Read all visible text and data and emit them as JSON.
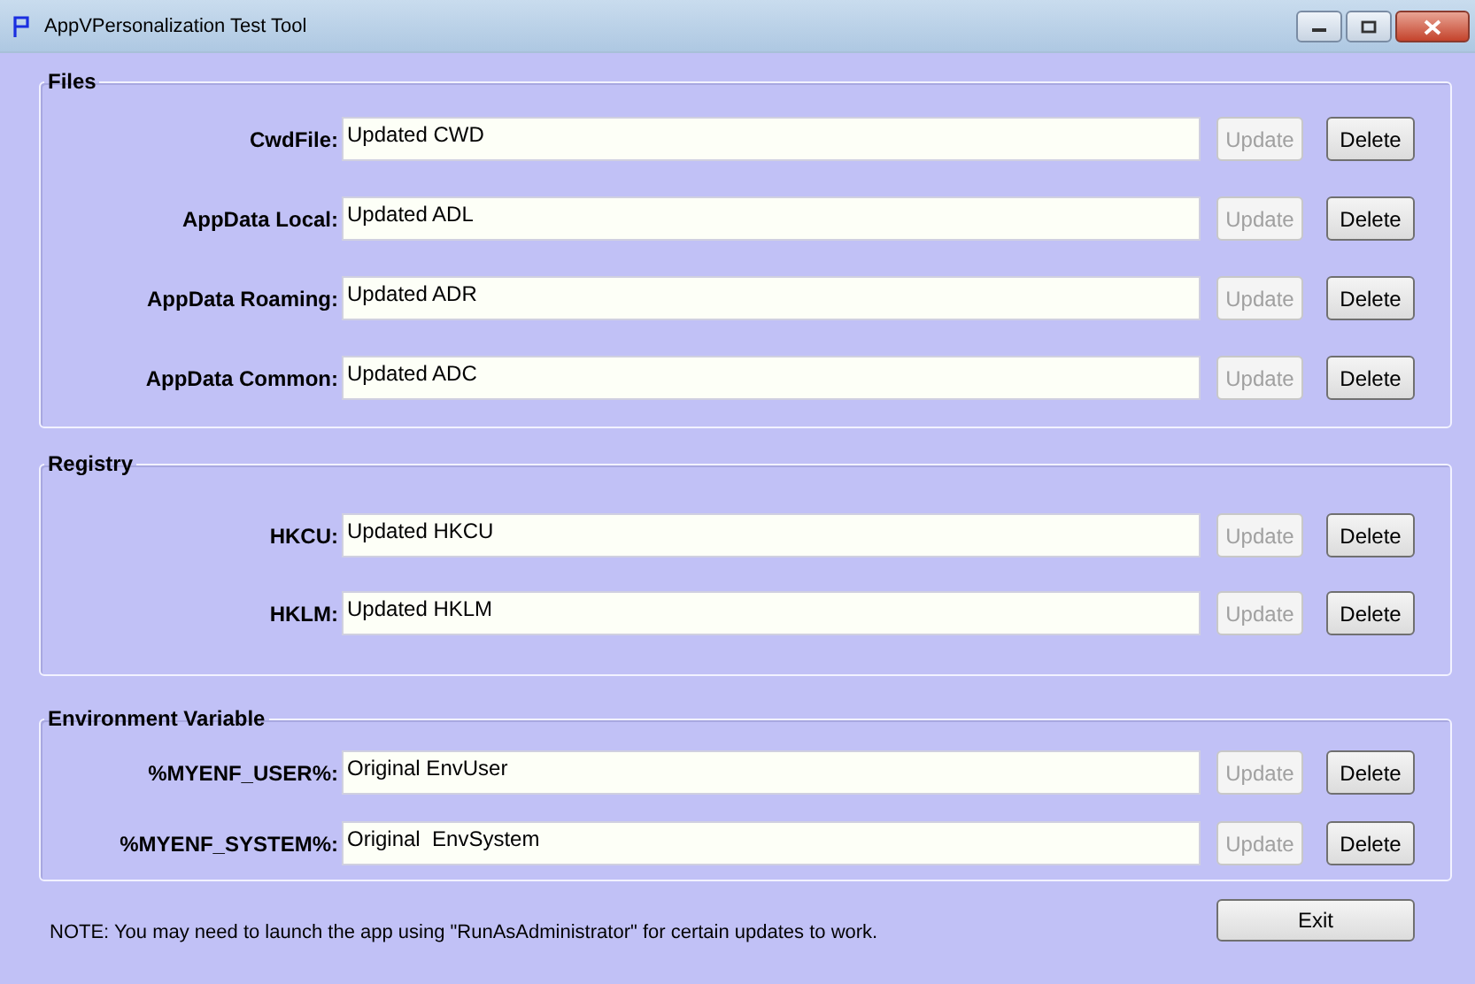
{
  "window": {
    "title": "AppVPersonalization Test Tool"
  },
  "groups": [
    {
      "title": "Files",
      "rows": [
        {
          "label": "CwdFile:",
          "value": "Updated CWD",
          "update": {
            "label": "Update",
            "disabled": true
          },
          "delete": {
            "label": "Delete",
            "disabled": false
          }
        },
        {
          "label": "AppData Local:",
          "value": "Updated ADL",
          "update": {
            "label": "Update",
            "disabled": true
          },
          "delete": {
            "label": "Delete",
            "disabled": false
          }
        },
        {
          "label": "AppData Roaming:",
          "value": "Updated ADR",
          "update": {
            "label": "Update",
            "disabled": true
          },
          "delete": {
            "label": "Delete",
            "disabled": false
          }
        },
        {
          "label": "AppData Common:",
          "value": "Updated ADC",
          "update": {
            "label": "Update",
            "disabled": true
          },
          "delete": {
            "label": "Delete",
            "disabled": false
          }
        }
      ]
    },
    {
      "title": "Registry",
      "rows": [
        {
          "label": "HKCU:",
          "value": "Updated HKCU",
          "update": {
            "label": "Update",
            "disabled": true
          },
          "delete": {
            "label": "Delete",
            "disabled": false
          }
        },
        {
          "label": "HKLM:",
          "value": "Updated HKLM",
          "update": {
            "label": "Update",
            "disabled": true
          },
          "delete": {
            "label": "Delete",
            "disabled": false
          }
        }
      ]
    },
    {
      "title": "Environment Variable",
      "rows": [
        {
          "label": "%MYENF_USER%:",
          "value": "Original EnvUser",
          "update": {
            "label": "Update",
            "disabled": true
          },
          "delete": {
            "label": "Delete",
            "disabled": false
          }
        },
        {
          "label": "%MYENF_SYSTEM%:",
          "value": "Original  EnvSystem",
          "update": {
            "label": "Update",
            "disabled": true
          },
          "delete": {
            "label": "Delete",
            "disabled": false
          }
        }
      ]
    }
  ],
  "note": "NOTE: You may need to launch the app using \"RunAsAdministrator\" for certain updates to work.",
  "exit_button": {
    "label": "Exit"
  }
}
